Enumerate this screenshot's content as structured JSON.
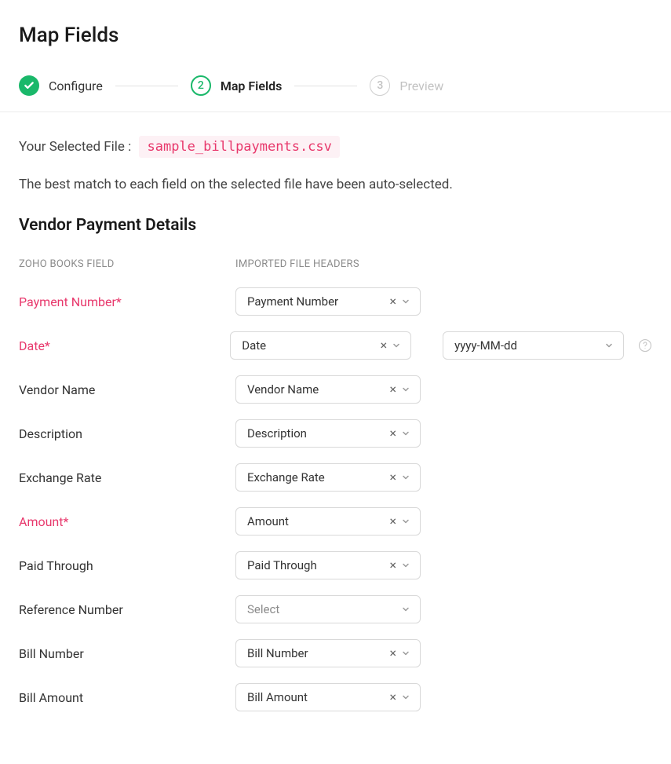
{
  "page_title": "Map Fields",
  "stepper": {
    "step1": {
      "label": "Configure"
    },
    "step2": {
      "num": "2",
      "label": "Map Fields"
    },
    "step3": {
      "num": "3",
      "label": "Preview"
    }
  },
  "file_row": {
    "prefix": "Your Selected File :",
    "file_name": "sample_billpayments.csv"
  },
  "hint": "The best match to each field on the selected file have been auto-selected.",
  "section_heading": "Vendor Payment Details",
  "table_headers": {
    "field": "ZOHO BOOKS FIELD",
    "header": "IMPORTED FILE HEADERS"
  },
  "date_format": "yyyy-MM-dd",
  "placeholder_select": "Select",
  "rows": {
    "payment_number": {
      "label": "Payment Number*",
      "value": "Payment Number",
      "required": true
    },
    "date": {
      "label": "Date*",
      "value": "Date",
      "required": true,
      "has_date_format": true
    },
    "vendor_name": {
      "label": "Vendor Name",
      "value": "Vendor Name"
    },
    "description": {
      "label": "Description",
      "value": "Description"
    },
    "exchange_rate": {
      "label": "Exchange Rate",
      "value": "Exchange Rate"
    },
    "amount": {
      "label": "Amount*",
      "value": "Amount",
      "required": true
    },
    "paid_through": {
      "label": "Paid Through",
      "value": "Paid Through"
    },
    "reference_number": {
      "label": "Reference Number",
      "value": "",
      "placeholder": true
    },
    "bill_number": {
      "label": "Bill Number",
      "value": "Bill Number"
    },
    "bill_amount": {
      "label": "Bill Amount",
      "value": "Bill Amount"
    }
  }
}
